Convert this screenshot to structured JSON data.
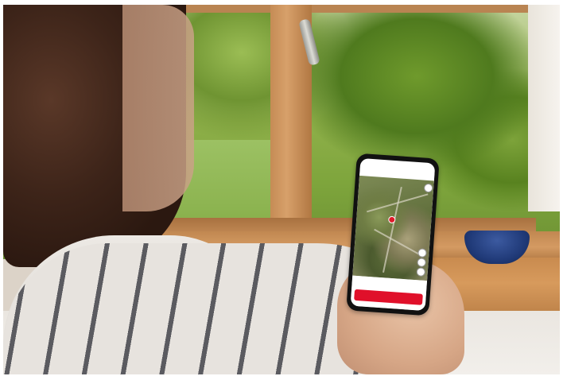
{
  "scene": {
    "description_tag": "person-holding-smartphone-with-map-app-by-window"
  },
  "phone": {
    "status_time": "",
    "status_icons": "",
    "app_title": "",
    "panel_label": "",
    "panel_value": "",
    "primary_button_label": ""
  },
  "colors": {
    "accent_red": "#e0102a",
    "window_frame": "#c58c55",
    "bowl_blue": "#203a78"
  },
  "icons": [
    "map-pin-icon",
    "map-control-icon"
  ]
}
